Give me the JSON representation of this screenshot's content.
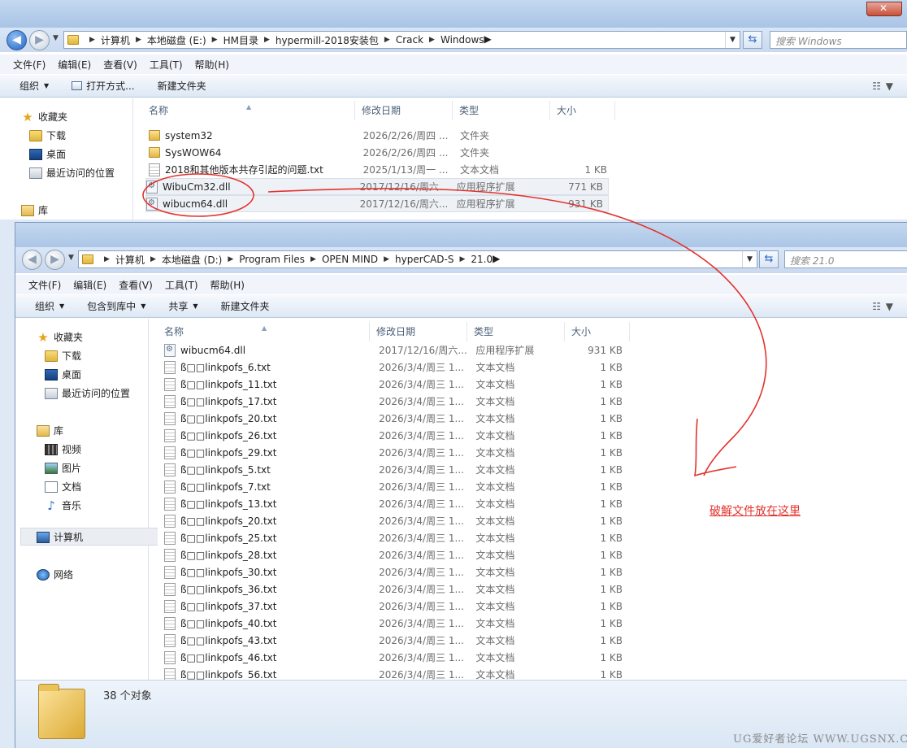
{
  "back_window": {
    "address": [
      "计算机",
      "本地磁盘 (E:)",
      "HM目录",
      "hypermill-2018安装包",
      "Crack",
      "Windows"
    ],
    "search_placeholder": "搜索 Windows",
    "menu": [
      "文件(F)",
      "编辑(E)",
      "查看(V)",
      "工具(T)",
      "帮助(H)"
    ],
    "toolbar": {
      "organize": "组织",
      "open_with": "打开方式...",
      "new_folder": "新建文件夹"
    },
    "nav": {
      "favorites": "收藏夹",
      "downloads": "下载",
      "desktop": "桌面",
      "recent": "最近访问的位置",
      "libraries": "库"
    },
    "columns": {
      "name": "名称",
      "date": "修改日期",
      "type": "类型",
      "size": "大小"
    },
    "files": [
      {
        "icon": "folder",
        "name": "system32",
        "date": "2026/2/26/周四 ...",
        "type": "文件夹",
        "size": ""
      },
      {
        "icon": "folder",
        "name": "SysWOW64",
        "date": "2026/2/26/周四 ...",
        "type": "文件夹",
        "size": ""
      },
      {
        "icon": "txt",
        "name": "2018和其他版本共存引起的问题.txt",
        "date": "2025/1/13/周一 ...",
        "type": "文本文档",
        "size": "1 KB"
      },
      {
        "icon": "dll",
        "name": "WibuCm32.dll",
        "date": "2017/12/16/周六...",
        "type": "应用程序扩展",
        "size": "771 KB"
      },
      {
        "icon": "dll",
        "name": "wibucm64.dll",
        "date": "2017/12/16/周六...",
        "type": "应用程序扩展",
        "size": "931 KB"
      }
    ]
  },
  "front_window": {
    "address": [
      "计算机",
      "本地磁盘 (D:)",
      "Program Files",
      "OPEN MIND",
      "hyperCAD-S",
      "21.0"
    ],
    "search_placeholder": "搜索 21.0",
    "menu": [
      "文件(F)",
      "编辑(E)",
      "查看(V)",
      "工具(T)",
      "帮助(H)"
    ],
    "toolbar": {
      "organize": "组织",
      "include_library": "包含到库中",
      "share": "共享",
      "new_folder": "新建文件夹"
    },
    "nav": {
      "favorites": "收藏夹",
      "downloads": "下载",
      "desktop": "桌面",
      "recent": "最近访问的位置",
      "libraries": "库",
      "videos": "视频",
      "pictures": "图片",
      "documents": "文档",
      "music": "音乐",
      "computer": "计算机",
      "network": "网络"
    },
    "columns": {
      "name": "名称",
      "date": "修改日期",
      "type": "类型",
      "size": "大小"
    },
    "files": [
      {
        "icon": "dll",
        "name": "wibucm64.dll",
        "date": "2017/12/16/周六...",
        "type": "应用程序扩展",
        "size": "931 KB"
      },
      {
        "icon": "txt",
        "name": "ß□□linkpofs_6.txt",
        "date": "2026/3/4/周三 1...",
        "type": "文本文档",
        "size": "1 KB"
      },
      {
        "icon": "txt",
        "name": "ß□□linkpofs_11.txt",
        "date": "2026/3/4/周三 1...",
        "type": "文本文档",
        "size": "1 KB"
      },
      {
        "icon": "txt",
        "name": "ß□□linkpofs_17.txt",
        "date": "2026/3/4/周三 1...",
        "type": "文本文档",
        "size": "1 KB"
      },
      {
        "icon": "txt",
        "name": "ß□□linkpofs_20.txt",
        "date": "2026/3/4/周三 1...",
        "type": "文本文档",
        "size": "1 KB"
      },
      {
        "icon": "txt",
        "name": "ß□□linkpofs_26.txt",
        "date": "2026/3/4/周三 1...",
        "type": "文本文档",
        "size": "1 KB"
      },
      {
        "icon": "txt",
        "name": "ß□□linkpofs_29.txt",
        "date": "2026/3/4/周三 1...",
        "type": "文本文档",
        "size": "1 KB"
      },
      {
        "icon": "txt",
        "name": "ß□□linkpofs_5.txt",
        "date": "2026/3/4/周三 1...",
        "type": "文本文档",
        "size": "1 KB"
      },
      {
        "icon": "txt",
        "name": "ß□□linkpofs_7.txt",
        "date": "2026/3/4/周三 1...",
        "type": "文本文档",
        "size": "1 KB"
      },
      {
        "icon": "txt",
        "name": "ß□□linkpofs_13.txt",
        "date": "2026/3/4/周三 1...",
        "type": "文本文档",
        "size": "1 KB"
      },
      {
        "icon": "txt",
        "name": "ß□□linkpofs_20.txt",
        "date": "2026/3/4/周三 1...",
        "type": "文本文档",
        "size": "1 KB"
      },
      {
        "icon": "txt",
        "name": "ß□□linkpofs_25.txt",
        "date": "2026/3/4/周三 1...",
        "type": "文本文档",
        "size": "1 KB"
      },
      {
        "icon": "txt",
        "name": "ß□□linkpofs_28.txt",
        "date": "2026/3/4/周三 1...",
        "type": "文本文档",
        "size": "1 KB"
      },
      {
        "icon": "txt",
        "name": "ß□□linkpofs_30.txt",
        "date": "2026/3/4/周三 1...",
        "type": "文本文档",
        "size": "1 KB"
      },
      {
        "icon": "txt",
        "name": "ß□□linkpofs_36.txt",
        "date": "2026/3/4/周三 1...",
        "type": "文本文档",
        "size": "1 KB"
      },
      {
        "icon": "txt",
        "name": "ß□□linkpofs_37.txt",
        "date": "2026/3/4/周三 1...",
        "type": "文本文档",
        "size": "1 KB"
      },
      {
        "icon": "txt",
        "name": "ß□□linkpofs_40.txt",
        "date": "2026/3/4/周三 1...",
        "type": "文本文档",
        "size": "1 KB"
      },
      {
        "icon": "txt",
        "name": "ß□□linkpofs_43.txt",
        "date": "2026/3/4/周三 1...",
        "type": "文本文档",
        "size": "1 KB"
      },
      {
        "icon": "txt",
        "name": "ß□□linkpofs_46.txt",
        "date": "2026/3/4/周三 1...",
        "type": "文本文档",
        "size": "1 KB"
      },
      {
        "icon": "txt",
        "name": "ß□□linkpofs_56.txt",
        "date": "2026/3/4/周三 1...",
        "type": "文本文档",
        "size": "1 KB"
      }
    ],
    "status": "38 个对象"
  },
  "annotation": {
    "note": "破解文件放在这里",
    "color": "#e4322c"
  },
  "watermark": "UG爱好者论坛 WWW.UGSNX.COM"
}
